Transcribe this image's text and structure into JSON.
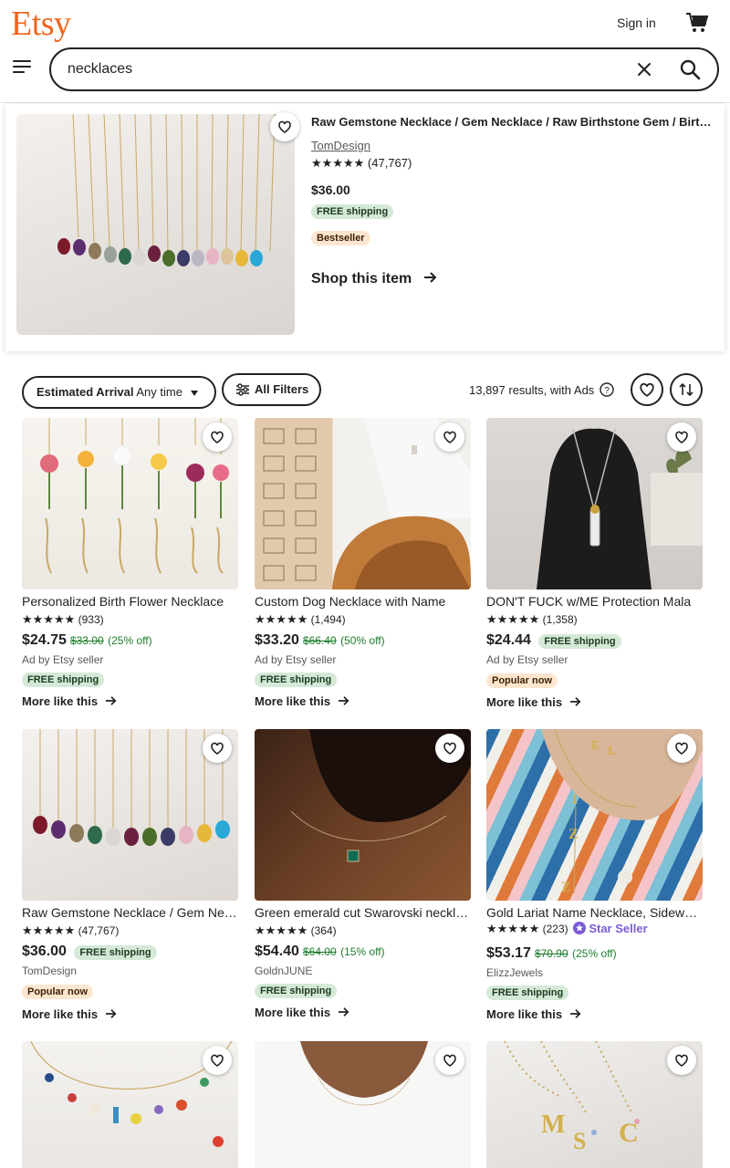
{
  "header": {
    "logo": "Etsy",
    "signin": "Sign in",
    "search_value": "necklaces"
  },
  "featured": {
    "title": "Raw Gemstone Necklace / Gem Necklace / Raw Birthstone Gem / Birthstone Necklace",
    "shop": "TomDesign",
    "stars": "★★★★★",
    "reviews": "(47,767)",
    "price": "$36.00",
    "shipping": "FREE shipping",
    "badge": "Bestseller",
    "cta": "Shop this item"
  },
  "filters": {
    "estimated_label": "Estimated Arrival",
    "estimated_value": "Any time",
    "all_filters": "All Filters",
    "results": "13,897 results, with Ads"
  },
  "colors": {
    "brand": "#f1641e",
    "green_badge": "#d4e9d7",
    "orange_badge": "#fde6cf",
    "star_seller": "#7b5bd6"
  },
  "listings": [
    {
      "title": "Personalized Birth Flower Necklace",
      "stars": "★★★★★",
      "reviews": "(933)",
      "price": "$24.75",
      "original": "$33.00",
      "discount": "(25% off)",
      "seller": "Ad by Etsy seller",
      "tag": "FREE shipping",
      "more": "More like this"
    },
    {
      "title": "Custom Dog Necklace with Name",
      "stars": "★★★★★",
      "reviews": "(1,494)",
      "price": "$33.20",
      "original": "$66.40",
      "discount": "(50% off)",
      "seller": "Ad by Etsy seller",
      "tag": "FREE shipping",
      "more": "More like this"
    },
    {
      "title": "DON'T FUCK w/ME Protection Mala",
      "stars": "★★★★★",
      "reviews": "(1,358)",
      "price": "$24.44",
      "inline_tag": "FREE shipping",
      "seller": "Ad by Etsy seller",
      "tag": "Popular now",
      "more": "More like this"
    },
    {
      "title": "Raw Gemstone Necklace / Gem Necklace",
      "stars": "★★★★★",
      "reviews": "(47,767)",
      "price": "$36.00",
      "inline_tag": "FREE shipping",
      "seller": "TomDesign",
      "tag": "Popular now",
      "more": "More like this"
    },
    {
      "title": "Green emerald cut Swarovski necklace",
      "stars": "★★★★★",
      "reviews": "(364)",
      "price": "$54.40",
      "original": "$64.00",
      "discount": "(15% off)",
      "seller": "GoldnJUNE",
      "tag": "FREE shipping",
      "more": "More like this"
    },
    {
      "title": "Gold Lariat Name Necklace, Sideways Initial",
      "stars": "★★★★★",
      "reviews": "(223)",
      "star_seller": "Star Seller",
      "price": "$53.17",
      "original": "$70.90",
      "discount": "(25% off)",
      "seller": "ElizzJewels",
      "tag": "FREE shipping",
      "more": "More like this"
    }
  ]
}
